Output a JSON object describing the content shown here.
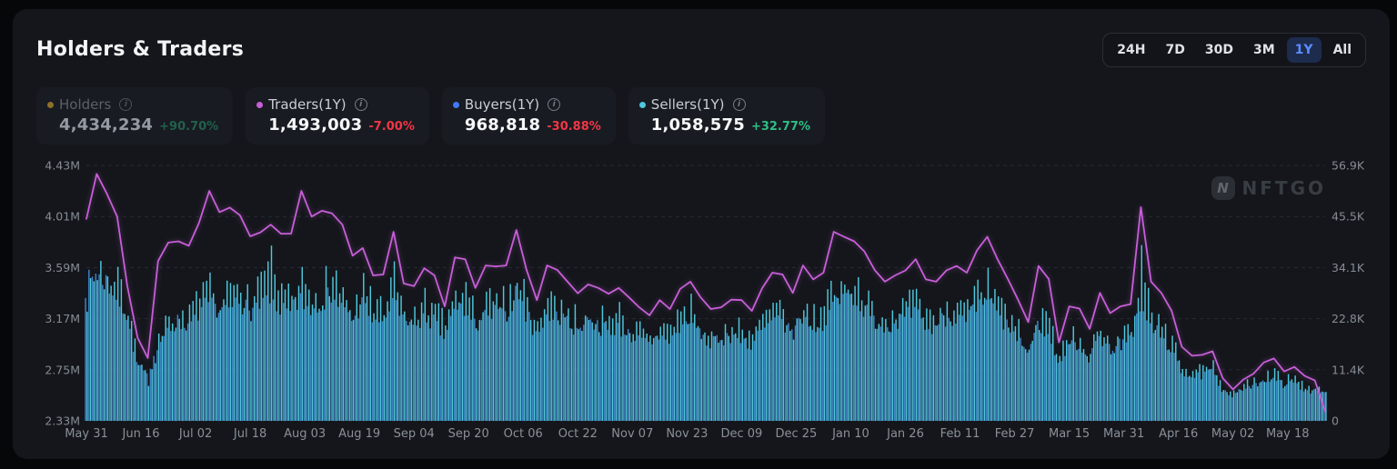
{
  "panel": {
    "title": "Holders & Traders"
  },
  "time_ranges": {
    "options": [
      "24H",
      "7D",
      "30D",
      "3M",
      "1Y",
      "All"
    ],
    "selected": "1Y"
  },
  "stats": [
    {
      "id": "holders",
      "label": "Holders",
      "value": "4,434,234",
      "change": "+90.70%",
      "direction": "up",
      "dot_color": "#8d702a",
      "state": "disabled"
    },
    {
      "id": "traders",
      "label": "Traders(1Y)",
      "value": "1,493,003",
      "change": "-7.00%",
      "direction": "down",
      "dot_color": "#c75fd8",
      "state": "active"
    },
    {
      "id": "buyers",
      "label": "Buyers(1Y)",
      "value": "968,818",
      "change": "-30.88%",
      "direction": "down",
      "dot_color": "#3e7bfa",
      "state": "active"
    },
    {
      "id": "sellers",
      "label": "Sellers(1Y)",
      "value": "1,058,575",
      "change": "+32.77%",
      "direction": "up",
      "dot_color": "#4fc8dc",
      "state": "active"
    }
  ],
  "watermark": "NFTGO",
  "colors": {
    "accent_blue": "#5b8cff",
    "positive": "#2ebd85",
    "negative": "#f23645",
    "grid": "#272b33",
    "panel_bg": "#14161b"
  },
  "chart_data": {
    "type": "composite",
    "title": "Holders & Traders (1Y)",
    "grid": "dashed horizontal",
    "legend_position": "top stat cards",
    "x_tick_labels": [
      "May 31",
      "Jun 16",
      "Jul 02",
      "Jul 18",
      "Aug 03",
      "Aug 19",
      "Sep 04",
      "Sep 20",
      "Oct 06",
      "Oct 22",
      "Nov 07",
      "Nov 23",
      "Dec 09",
      "Dec 25",
      "Jan 10",
      "Jan 26",
      "Feb 11",
      "Feb 27",
      "Mar 15",
      "Mar 31",
      "Apr 16",
      "May 02",
      "May 18"
    ],
    "x_tick_interval_days": 16,
    "sample_interval_days": 3,
    "left_axis": {
      "tick_labels": [
        "4.43M",
        "4.01M",
        "3.59M",
        "3.17M",
        "2.75M",
        "2.33M"
      ],
      "min": 2330000,
      "max": 4430000,
      "note": "Holders scale (series toggled off)"
    },
    "right_axis": {
      "tick_labels": [
        "56.9K",
        "45.5K",
        "34.1K",
        "22.8K",
        "11.4K",
        "0"
      ],
      "min": 0,
      "max": 56900
    },
    "series": [
      {
        "name": "Traders(1Y)",
        "type": "line",
        "axis": "right",
        "unit": "K",
        "color": "#c75fd8",
        "values": [
          45.0,
          55.0,
          50.6,
          45.5,
          30.0,
          18.5,
          14.0,
          35.6,
          39.7,
          40.0,
          39.0,
          44.1,
          51.2,
          46.5,
          47.5,
          45.8,
          41.1,
          42.0,
          43.7,
          41.7,
          41.7,
          51.2,
          45.5,
          46.8,
          46.2,
          43.7,
          36.8,
          38.5,
          32.4,
          32.6,
          42.1,
          30.6,
          30.0,
          34.0,
          32.4,
          25.5,
          36.4,
          36.0,
          29.6,
          34.6,
          34.4,
          34.6,
          42.5,
          33.6,
          26.9,
          34.6,
          33.6,
          31.0,
          28.4,
          30.4,
          29.6,
          28.3,
          29.6,
          27.5,
          25.3,
          23.5,
          26.9,
          24.9,
          29.4,
          31.0,
          27.5,
          24.9,
          25.3,
          27.0,
          26.9,
          24.5,
          29.5,
          33.0,
          32.6,
          28.5,
          34.6,
          31.5,
          33.0,
          42.1,
          41.0,
          40.0,
          37.7,
          33.6,
          31.0,
          32.4,
          33.5,
          36.0,
          31.5,
          31.0,
          33.5,
          34.5,
          33.0,
          38.0,
          41.0,
          36.0,
          31.6,
          27.0,
          22.0,
          34.5,
          31.6,
          17.5,
          25.5,
          25.0,
          20.5,
          28.5,
          24.0,
          25.5,
          26.0,
          47.6,
          31.0,
          28.5,
          24.5,
          16.5,
          14.5,
          14.7,
          15.5,
          9.5,
          7.0,
          9.2,
          10.5,
          13.0,
          13.9,
          11.0,
          12.0,
          10.0,
          9.0,
          2.1
        ]
      },
      {
        "name": "Buyers(1Y)",
        "type": "bar",
        "axis": "right",
        "unit": "K",
        "color": "#3f86c9",
        "values": [
          30,
          33,
          31,
          28,
          24,
          13,
          10,
          17,
          20,
          22,
          21,
          24,
          26,
          24,
          25,
          27,
          24,
          26,
          28,
          25,
          24,
          27,
          25,
          26,
          28,
          25,
          22,
          26,
          23,
          22,
          27,
          22,
          21,
          23,
          22,
          19,
          24,
          25,
          21,
          23,
          24,
          23,
          28,
          24,
          19,
          24,
          23,
          22,
          20,
          22,
          21,
          20,
          21,
          19,
          18,
          17,
          19,
          18,
          21,
          22,
          19,
          17,
          18,
          19,
          18,
          17,
          20,
          22,
          22,
          19,
          23,
          21,
          22,
          26,
          27,
          28,
          25,
          22,
          21,
          22,
          23,
          24,
          21,
          21,
          23,
          23,
          22,
          25,
          27,
          24,
          21,
          18,
          15,
          21,
          20,
          13,
          17,
          17,
          14,
          19,
          16,
          17,
          18,
          25,
          21,
          19,
          16,
          11,
          10,
          10,
          11,
          7,
          5.5,
          7,
          7.5,
          9,
          9.5,
          8,
          8.5,
          7,
          6.5,
          6
        ]
      },
      {
        "name": "Sellers(1Y)",
        "type": "bar",
        "axis": "right",
        "unit": "K",
        "color": "#4fc8dc",
        "values": [
          28,
          34,
          32,
          30,
          25,
          12,
          9,
          18,
          22,
          24,
          23,
          27,
          29,
          26,
          28,
          31,
          26,
          29,
          34,
          28,
          26,
          31,
          28,
          30,
          33,
          28,
          24,
          30,
          25,
          24,
          31,
          24,
          23,
          26,
          24,
          21,
          28,
          29,
          23,
          26,
          27,
          26,
          33,
          28,
          21,
          27,
          26,
          24,
          22,
          25,
          23,
          22,
          24,
          21,
          20,
          18,
          21,
          20,
          24,
          25,
          21,
          18,
          20,
          21,
          20,
          19,
          22,
          25,
          24,
          21,
          26,
          23,
          24,
          29,
          30,
          31,
          27,
          24,
          23,
          24,
          25,
          27,
          23,
          23,
          26,
          25,
          24,
          28,
          30,
          26,
          23,
          20,
          16,
          23,
          22,
          14,
          19,
          18,
          15,
          21,
          17,
          18,
          20,
          36,
          23,
          21,
          17,
          12,
          11,
          11,
          12,
          8,
          6,
          8,
          8.5,
          10,
          10.5,
          9,
          9.5,
          8,
          7,
          6.5
        ]
      }
    ],
    "render_hints": {
      "bar_jitter_seed": 7,
      "buyers_jitter": 0.09,
      "sellers_jitter": 0.15
    }
  }
}
